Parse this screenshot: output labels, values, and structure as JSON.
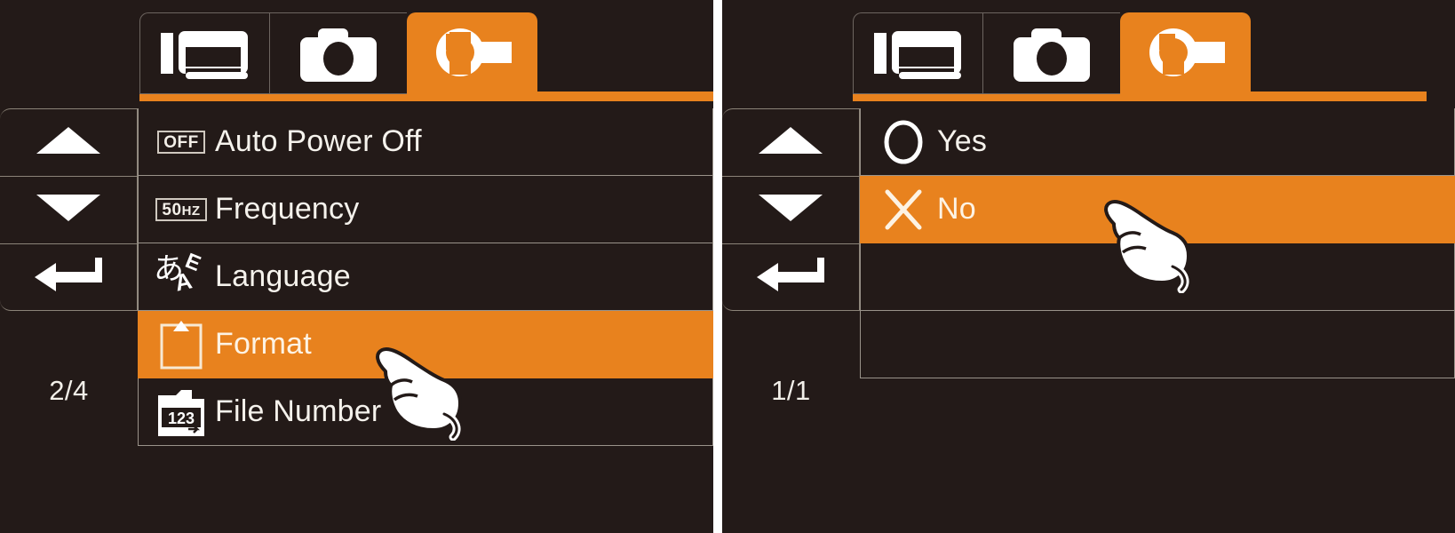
{
  "theme": {
    "background": "#ffffff",
    "panel_bg": "#231a18",
    "accent": "#e8821e",
    "text": "#f5f2ec",
    "border": "#9a938a"
  },
  "panels": [
    {
      "name": "settings-menu-panel",
      "tabs": [
        {
          "icon": "playback-gallery-icon",
          "label": "Playback",
          "active": false
        },
        {
          "icon": "camera-icon",
          "label": "Camera",
          "active": false
        },
        {
          "icon": "wrench-setup-icon",
          "label": "Setup",
          "active": true
        }
      ],
      "nav": {
        "up_label": "Up",
        "down_label": "Down",
        "enter_label": "Enter",
        "page_indicator": "2/4"
      },
      "rows": [
        {
          "icon": "off-badge-icon",
          "icon_text": "OFF",
          "label": "Auto Power Off",
          "selected": false
        },
        {
          "icon": "fifty-hz-badge-icon",
          "icon_text": "50HZ",
          "label": "Frequency",
          "selected": false
        },
        {
          "icon": "language-icon",
          "icon_text": "",
          "label": "Language",
          "selected": false
        },
        {
          "icon": "format-card-icon",
          "icon_text": "",
          "label": "Format",
          "selected": true
        },
        {
          "icon": "file-number-folder-icon",
          "icon_text": "123",
          "label": "File Number",
          "selected": false
        }
      ],
      "cursor": {
        "icon": "pointing-hand-cursor",
        "target_label": "Format"
      }
    },
    {
      "name": "format-confirm-panel",
      "tabs": [
        {
          "icon": "playback-gallery-icon",
          "label": "Playback",
          "active": false
        },
        {
          "icon": "camera-icon",
          "label": "Camera",
          "active": false
        },
        {
          "icon": "wrench-setup-icon",
          "label": "Setup",
          "active": true
        }
      ],
      "nav": {
        "up_label": "Up",
        "down_label": "Down",
        "enter_label": "Enter",
        "page_indicator": "1/1"
      },
      "rows": [
        {
          "icon": "circle-yes-icon",
          "icon_text": "",
          "label": "Yes",
          "selected": false
        },
        {
          "icon": "cross-no-icon",
          "icon_text": "",
          "label": "No",
          "selected": true
        },
        {
          "icon": "",
          "icon_text": "",
          "label": "",
          "selected": false
        },
        {
          "icon": "",
          "icon_text": "",
          "label": "",
          "selected": false
        }
      ],
      "cursor": {
        "icon": "pointing-hand-cursor",
        "target_label": "No"
      }
    }
  ]
}
